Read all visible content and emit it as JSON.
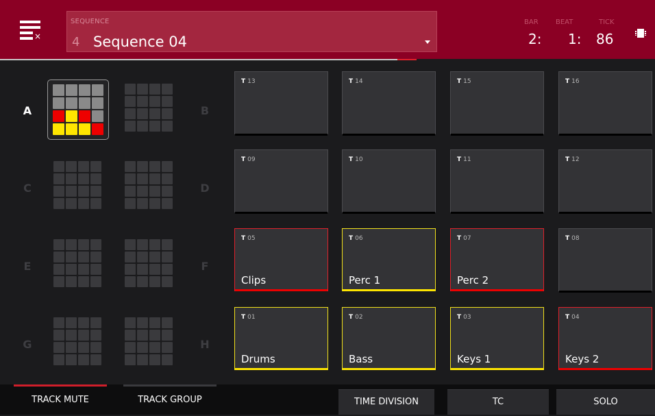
{
  "header": {
    "sequence_caption": "SEQUENCE",
    "sequence_number": "4",
    "sequence_name": "Sequence 04",
    "bar_caption": "BAR",
    "bar_value": "2:",
    "beat_caption": "BEAT",
    "beat_value": "1:",
    "tick_caption": "TICK",
    "tick_value": "86"
  },
  "groups": [
    "A",
    "B",
    "C",
    "D",
    "E",
    "F",
    "G",
    "H"
  ],
  "selected_group": "A",
  "tracks": [
    {
      "num": "13",
      "name": ""
    },
    {
      "num": "14",
      "name": ""
    },
    {
      "num": "15",
      "name": ""
    },
    {
      "num": "16",
      "name": ""
    },
    {
      "num": "09",
      "name": ""
    },
    {
      "num": "10",
      "name": ""
    },
    {
      "num": "11",
      "name": ""
    },
    {
      "num": "12",
      "name": ""
    },
    {
      "num": "05",
      "name": "Clips"
    },
    {
      "num": "06",
      "name": "Perc 1"
    },
    {
      "num": "07",
      "name": "Perc 2"
    },
    {
      "num": "08",
      "name": ""
    },
    {
      "num": "01",
      "name": "Drums"
    },
    {
      "num": "02",
      "name": "Bass"
    },
    {
      "num": "03",
      "name": "Keys 1"
    },
    {
      "num": "04",
      "name": "Keys 2"
    }
  ],
  "track_prefix": "T",
  "footer": {
    "track_mute": "TRACK MUTE",
    "track_group": "TRACK GROUP",
    "time_division": "TIME DIVISION",
    "tc": "TC",
    "solo": "SOLO"
  },
  "colors": {
    "header_bg": "#8b0024",
    "mute_red": "#ee0000",
    "solo_yellow": "#ffe600",
    "active_tab": "#d01e2a"
  }
}
